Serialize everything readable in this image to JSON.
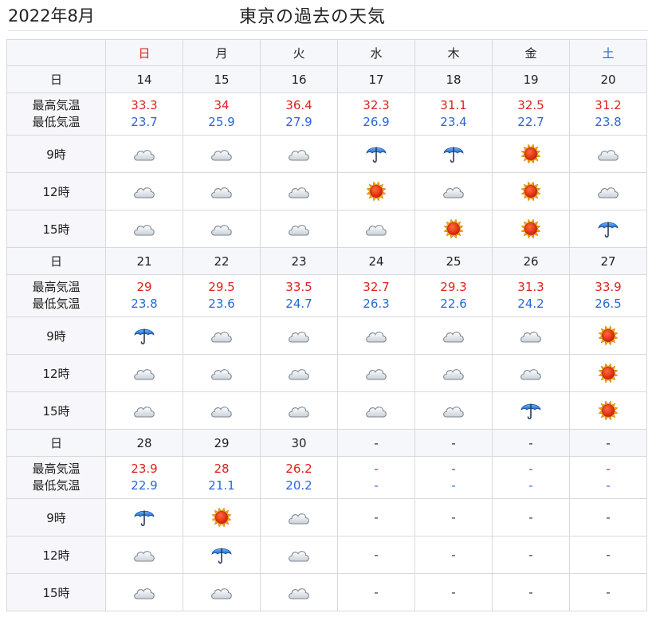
{
  "header": {
    "month": "2022年8月",
    "title": "東京の過去の天気"
  },
  "labels": {
    "day": "日",
    "temps": [
      "最高気温",
      "最低気温"
    ],
    "times": [
      "9時",
      "12時",
      "15時"
    ]
  },
  "weekdays": [
    "日",
    "月",
    "火",
    "水",
    "木",
    "金",
    "土"
  ],
  "colors": {
    "high": "#e02020",
    "low": "#2b66d9",
    "sunday": "#e02020",
    "saturday": "#2b66d9"
  },
  "weeks": [
    {
      "dates": [
        "14",
        "15",
        "16",
        "17",
        "18",
        "19",
        "20"
      ],
      "highs": [
        "33.3",
        "34",
        "36.4",
        "32.3",
        "31.1",
        "32.5",
        "31.2"
      ],
      "lows": [
        "23.7",
        "25.9",
        "27.9",
        "26.9",
        "23.4",
        "22.7",
        "23.8"
      ],
      "weather": [
        [
          "cloud-icon",
          "cloud-icon",
          "cloud-icon",
          "umbrella-icon",
          "umbrella-icon",
          "sun-icon",
          "cloud-icon"
        ],
        [
          "cloud-icon",
          "cloud-icon",
          "cloud-icon",
          "sun-icon",
          "cloud-icon",
          "sun-icon",
          "cloud-icon"
        ],
        [
          "cloud-icon",
          "cloud-icon",
          "cloud-icon",
          "cloud-icon",
          "sun-icon",
          "sun-icon",
          "umbrella-icon"
        ]
      ]
    },
    {
      "dates": [
        "21",
        "22",
        "23",
        "24",
        "25",
        "26",
        "27"
      ],
      "highs": [
        "29",
        "29.5",
        "33.5",
        "32.7",
        "29.3",
        "31.3",
        "33.9"
      ],
      "lows": [
        "23.8",
        "23.6",
        "24.7",
        "26.3",
        "22.6",
        "24.2",
        "26.5"
      ],
      "weather": [
        [
          "umbrella-icon",
          "cloud-icon",
          "cloud-icon",
          "cloud-icon",
          "cloud-icon",
          "cloud-icon",
          "sun-icon"
        ],
        [
          "cloud-icon",
          "cloud-icon",
          "cloud-icon",
          "cloud-icon",
          "cloud-icon",
          "cloud-icon",
          "sun-icon"
        ],
        [
          "cloud-icon",
          "cloud-icon",
          "cloud-icon",
          "cloud-icon",
          "cloud-icon",
          "umbrella-icon",
          "sun-icon"
        ]
      ]
    },
    {
      "dates": [
        "28",
        "29",
        "30",
        "-",
        "-",
        "-",
        "-"
      ],
      "highs": [
        "23.9",
        "28",
        "26.2",
        "-",
        "-",
        "-",
        "-"
      ],
      "lows": [
        "22.9",
        "21.1",
        "20.2",
        "-",
        "-",
        "-",
        "-"
      ],
      "weather": [
        [
          "umbrella-icon",
          "sun-icon",
          "cloud-icon",
          "-",
          "-",
          "-",
          "-"
        ],
        [
          "cloud-icon",
          "umbrella-icon",
          "cloud-icon",
          "-",
          "-",
          "-",
          "-"
        ],
        [
          "cloud-icon",
          "cloud-icon",
          "cloud-icon",
          "-",
          "-",
          "-",
          "-"
        ]
      ]
    }
  ]
}
